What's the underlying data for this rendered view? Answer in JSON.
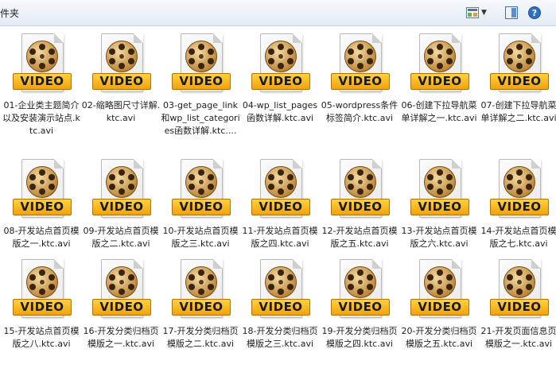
{
  "window": {
    "breadcrumb": "件夹",
    "icons": {
      "view": "view-options-icon",
      "view_chevron": "chevron-down-icon",
      "preview": "preview-pane-icon",
      "help": "help-icon"
    }
  },
  "badge_text": "VIDEO",
  "colors": {
    "badge": "#f5b21a",
    "reel": "#c08a3c",
    "toolbar": "#e3ebf6"
  },
  "files": [
    {
      "label": "01-企业类主题简介以及安装演示站点.ktc.avi"
    },
    {
      "label": "02-缩略图尺寸详解.ktc.avi"
    },
    {
      "label": "03-get_page_link和wp_list_categories函数详解.ktc...."
    },
    {
      "label": "04-wp_list_pages函数详解.ktc.avi"
    },
    {
      "label": "05-wordpress条件标签简介.ktc.avi"
    },
    {
      "label": "06-创建下拉导航菜单详解之一.ktc.avi"
    },
    {
      "label": "07-创建下拉导航菜单详解之二.ktc.avi"
    },
    {
      "label": "08-开发站点首页模版之一.ktc.avi"
    },
    {
      "label": "09-开发站点首页模版之二.ktc.avi"
    },
    {
      "label": "10-开发站点首页模版之三.ktc.avi"
    },
    {
      "label": "11-开发站点首页模版之四.ktc.avi"
    },
    {
      "label": "12-开发站点首页模版之五.ktc.avi"
    },
    {
      "label": "13-开发站点首页模版之六.ktc.avi"
    },
    {
      "label": "14-开发站点首页模版之七.ktc.avi"
    },
    {
      "label": "15-开发站点首页模版之八.ktc.avi"
    },
    {
      "label": "16-开发分类归档页模版之一.ktc.avi"
    },
    {
      "label": "17-开发分类归档页模版之二.ktc.avi"
    },
    {
      "label": "18-开发分类归档页模版之三.ktc.avi"
    },
    {
      "label": "19-开发分类归档页模版之四.ktc.avi"
    },
    {
      "label": "20-开发分类归档页模版之五.ktc.avi"
    },
    {
      "label": "21-开发页面信息页模版之一.ktc.avi"
    }
  ]
}
